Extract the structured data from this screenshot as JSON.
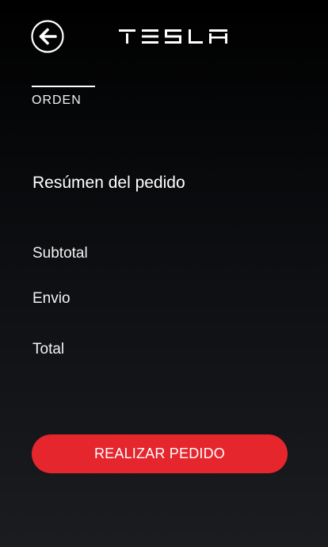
{
  "header": {
    "back_icon": "arrow-left-circle-icon",
    "brand": "TESLA"
  },
  "tabs": [
    {
      "label": "ORDEN",
      "active": true
    }
  ],
  "summary": {
    "title": "Resúmen del pedido",
    "rows": [
      {
        "label": "Subtotal"
      },
      {
        "label": "Envio"
      },
      {
        "label": "Total"
      }
    ]
  },
  "cta": {
    "label": "REALIZAR PEDIDO"
  },
  "colors": {
    "accent": "#e5262d",
    "background_top": "#000000",
    "background_bottom": "#1a1c20",
    "text": "#ffffff"
  }
}
